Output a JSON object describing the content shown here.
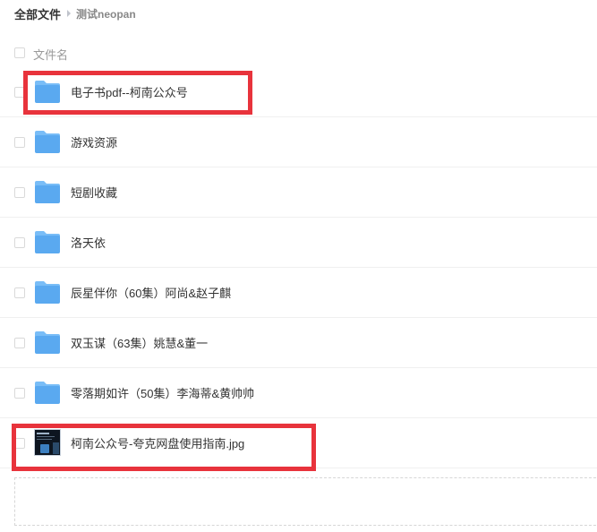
{
  "breadcrumb": {
    "root": "全部文件",
    "current": "测试neopan"
  },
  "header": {
    "name_label": "文件名"
  },
  "files": [
    {
      "name": "电子书pdf--柯南公众号",
      "type": "folder"
    },
    {
      "name": "游戏资源",
      "type": "folder"
    },
    {
      "name": "短剧收藏",
      "type": "folder"
    },
    {
      "name": "洛天依",
      "type": "folder"
    },
    {
      "name": "辰星伴你（60集）阿尚&赵子麒",
      "type": "folder"
    },
    {
      "name": "双玉谋（63集）姚慧&董一",
      "type": "folder"
    },
    {
      "name": "零落期如许（50集）李海蒂&黄帅帅",
      "type": "folder"
    },
    {
      "name": "柯南公众号-夸克网盘使用指南.jpg",
      "type": "image"
    }
  ],
  "colors": {
    "folder": "#5aa9f0",
    "folder_tab": "#79bdf7",
    "highlight": "#e8333c"
  }
}
